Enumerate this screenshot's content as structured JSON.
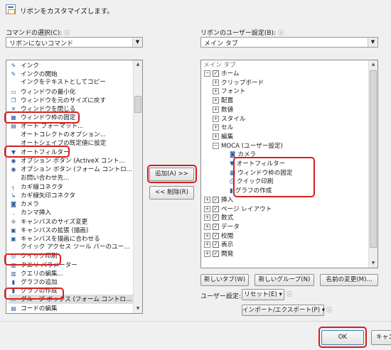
{
  "header": {
    "title": "リボンをカスタマイズします。"
  },
  "left": {
    "label": "コマンドの選択(C):",
    "info_icon": "ⓘ",
    "combo_value": "リボンにないコマンド",
    "items": [
      {
        "label": "インク",
        "icon": "pen-icon",
        "glyph": "✎"
      },
      {
        "label": "インクの開始",
        "icon": "pen-icon",
        "glyph": "✎"
      },
      {
        "label": "インクをテキストとしてコピー",
        "icon": "",
        "glyph": ""
      },
      {
        "label": "ウィンドウの最小化",
        "icon": "minimize-icon",
        "glyph": "▭"
      },
      {
        "label": "ウィンドウを元のサイズに戻す",
        "icon": "restore-icon",
        "glyph": "❐"
      },
      {
        "label": "ウィンドウを閉じる",
        "icon": "close-icon",
        "glyph": "✕"
      },
      {
        "label": "ウィンドウ枠の固定",
        "icon": "freeze-panes-icon",
        "glyph": "▦"
      },
      {
        "label": "オート フォーマット...",
        "icon": "autoformat-icon",
        "glyph": "▤"
      },
      {
        "label": "オートコレクトのオプション...",
        "icon": "",
        "glyph": ""
      },
      {
        "label": "オートシェイプの既定値に設定",
        "icon": "",
        "glyph": ""
      },
      {
        "label": "オートフィルター",
        "icon": "funnel-icon",
        "glyph": "▼"
      },
      {
        "label": "オプション ボタン (ActiveX コント...",
        "icon": "radio-icon",
        "glyph": "◉"
      },
      {
        "label": "オプション ボタン (フォーム コントロ...",
        "icon": "radio-icon",
        "glyph": "◉"
      },
      {
        "label": "お問い合わせ先...",
        "icon": "",
        "glyph": ""
      },
      {
        "label": "カギ線コネクタ",
        "icon": "elbow-connector-icon",
        "glyph": "┐"
      },
      {
        "label": "カギ線矢印コネクタ",
        "icon": "elbow-arrow-icon",
        "glyph": "↳"
      },
      {
        "label": "カメラ",
        "icon": "camera-icon",
        "glyph": "◙"
      },
      {
        "label": "カンマ挿入",
        "icon": "comma-icon",
        "glyph": ","
      },
      {
        "label": "キャンバスのサイズ変更",
        "icon": "canvas-resize-icon",
        "glyph": "✢"
      },
      {
        "label": "キャンバスの拡張 (描画)",
        "icon": "canvas-expand-icon",
        "glyph": "▣"
      },
      {
        "label": "キャンバスを描画に合わせる",
        "icon": "canvas-fit-icon",
        "glyph": "▣"
      },
      {
        "label": "クイック アクセス ツール バーのユー...",
        "icon": "",
        "glyph": ""
      },
      {
        "label": "クイック印刷",
        "icon": "printer-icon",
        "glyph": "⎙"
      },
      {
        "label": "クエリ パラメーター",
        "icon": "query-icon",
        "glyph": "▥"
      },
      {
        "label": "クエリの編集...",
        "icon": "query-edit-icon",
        "glyph": "▥"
      },
      {
        "label": "グラフの追加",
        "icon": "chart-icon",
        "glyph": "▮"
      },
      {
        "label": "グラフの作成",
        "icon": "chart-icon",
        "glyph": "▮"
      },
      {
        "label": "グループ ボックス (フォーム コントロ...",
        "icon": "group-box-icon",
        "glyph": "▭"
      },
      {
        "label": "コードの編集",
        "icon": "code-icon",
        "glyph": "▤"
      }
    ]
  },
  "middle": {
    "add_button": "追加(A) >>",
    "remove_button": "<< 削除(R)"
  },
  "right": {
    "label": "リボンのユーザー設定(B):",
    "info_icon": "ⓘ",
    "combo_value": "メイン タブ",
    "tree_header": "メイン タブ",
    "tree": [
      {
        "label": "ホーム",
        "pm": "⊟",
        "cb": "✓",
        "level": 0
      },
      {
        "label": "クリップボード",
        "pm": "⊞",
        "cb": "",
        "level": 1
      },
      {
        "label": "フォント",
        "pm": "⊞",
        "cb": "",
        "level": 1
      },
      {
        "label": "配置",
        "pm": "⊞",
        "cb": "",
        "level": 1
      },
      {
        "label": "数値",
        "pm": "⊞",
        "cb": "",
        "level": 1
      },
      {
        "label": "スタイル",
        "pm": "⊞",
        "cb": "",
        "level": 1
      },
      {
        "label": "セル",
        "pm": "⊞",
        "cb": "",
        "level": 1
      },
      {
        "label": "編集",
        "pm": "⊞",
        "cb": "",
        "level": 1
      },
      {
        "label": "MOCA (ユーザー設定)",
        "pm": "⊟",
        "cb": "",
        "level": 1
      },
      {
        "label": "カメラ",
        "pm": "",
        "cb": "",
        "level": 2,
        "glyph": "◙"
      },
      {
        "label": "オートフィルター",
        "pm": "",
        "cb": "",
        "level": 2,
        "glyph": "▼"
      },
      {
        "label": "ウィンドウ枠の固定",
        "pm": "",
        "cb": "",
        "level": 2,
        "glyph": "▦"
      },
      {
        "label": "クイック印刷",
        "pm": "",
        "cb": "",
        "level": 2,
        "glyph": "⎙"
      },
      {
        "label": "グラフの作成",
        "pm": "",
        "cb": "",
        "level": 2,
        "glyph": "▮"
      },
      {
        "label": "挿入",
        "pm": "⊞",
        "cb": "✓",
        "level": 0
      },
      {
        "label": "ページ レイアウト",
        "pm": "⊞",
        "cb": "✓",
        "level": 0
      },
      {
        "label": "数式",
        "pm": "⊞",
        "cb": "✓",
        "level": 0
      },
      {
        "label": "データ",
        "pm": "⊞",
        "cb": "✓",
        "level": 0
      },
      {
        "label": "校閲",
        "pm": "⊞",
        "cb": "✓",
        "level": 0
      },
      {
        "label": "表示",
        "pm": "⊞",
        "cb": "✓",
        "level": 0
      },
      {
        "label": "開発",
        "pm": "⊞",
        "cb": "✓",
        "level": 0
      }
    ],
    "new_tab_button": "新しいタブ(W)",
    "new_group_button": "新しいグループ(N)",
    "rename_button": "名前の変更(M)...",
    "user_settings_label": "ユーザー設定:",
    "reset_button": "リセット(E) ▾",
    "import_export_button": "インポート/エクスポート(P) ▾"
  },
  "footer": {
    "ok_button": "OK",
    "cancel_button": "キャン"
  },
  "colors": {
    "highlight": "#d42020",
    "window": "#f0f0f0"
  }
}
